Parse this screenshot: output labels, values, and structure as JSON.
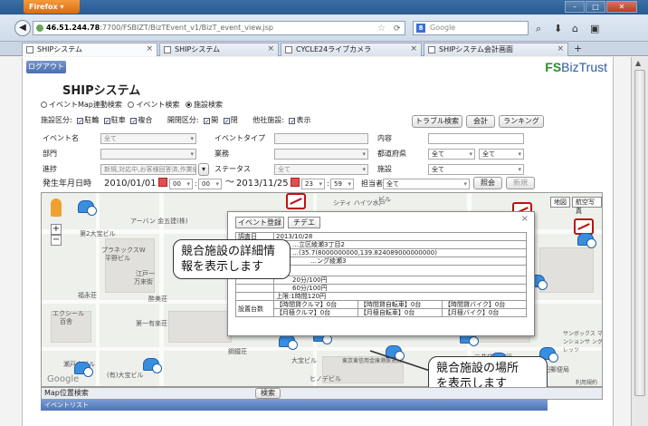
{
  "browser": {
    "firefox_label": "Firefox ▾",
    "window_controls": [
      "–",
      "□",
      "✕"
    ],
    "url_host": "46.51.244.78",
    "url_path": ":7700/FSBIZT/BizTEvent_v1/BizT_event_view.jsp",
    "search_placeholder": "Google",
    "tabs": [
      {
        "label": "SHIPシステム"
      },
      {
        "label": "SHIPシステム"
      },
      {
        "label": "CYCLE24ライブカメラ"
      },
      {
        "label": "SHIPシステム会計画面"
      }
    ],
    "new_tab": "+"
  },
  "header": {
    "logout": "ログアウト",
    "brand_fs": "FS",
    "brand_rest": "BizTrust",
    "title": "SHIPシステム"
  },
  "search_modes": [
    "イベントMap連動検索",
    "イベント検索",
    "施設検索"
  ],
  "filters": {
    "facility_type_label": "施設区分:",
    "facility_types": [
      "駐輪",
      "駐車",
      "複合"
    ],
    "open_label": "開閉区分:",
    "open_types": [
      "開",
      "閉"
    ],
    "other_label": "他社施設:",
    "other_types": [
      "表示"
    ]
  },
  "buttons": {
    "trouble": "トラブル検索",
    "accounting": "会計",
    "ranking": "ランキング",
    "view": "照会",
    "new": "新規"
  },
  "form": {
    "event_name_label": "イベント名",
    "event_name_value": "全て",
    "event_type_label": "イベントタイプ",
    "content_label": "内容",
    "dept_label": "部門",
    "business_label": "業務",
    "pref_label": "都道府県",
    "pref_value": "全て",
    "city_value": "全て",
    "progress_label": "進捗",
    "progress_value": "新規,対応中,お客様回答済,作業依頼中",
    "status_label": "ステータス",
    "status_value": "全て",
    "facility_label": "施設",
    "facility_value": "全て",
    "date_label": "発生年月日時",
    "date_from": "2010/01/01",
    "hour_from": "00",
    "min_from": "00",
    "tilde": "〜",
    "date_to": "2013/11/25",
    "hour_to": "23",
    "min_to": "59",
    "assignee_label": "担当者",
    "assignee_value": "全て"
  },
  "map": {
    "labels": {
      "l1": "アーバン 金五建(株)",
      "l2": "第2大宝ビル",
      "l3": "プラネックスW",
      "l4": "平野ビル",
      "l5": "江戸一",
      "l6": "万来街",
      "l7": "福永荘",
      "l8": "酔美荘",
      "l9": "エクシール",
      "l10": "百舎",
      "l11": "第一有楽荘",
      "l12": "瀬戸内ビル",
      "l13": "(有)大宝ビル",
      "l14": "大宝ビル",
      "l15": "東京東信用金庫港原支店",
      "l16": "ヒノデビル",
      "l17": "サンボックス マンションサ ングレッツ",
      "l18": "三井住友銀行",
      "l19": "瀬田郵便局",
      "l20": "シティ ハイツ水戸",
      "l21": "鋼鐵荘",
      "l22": "ビル",
      "l23": "Google",
      "l24": "利用規約"
    },
    "map_types": [
      "地図",
      "航空写真"
    ],
    "zoom_in": "+",
    "zoom_out": "−"
  },
  "popup": {
    "tabs": [
      "イベント登録",
      "チデエ"
    ],
    "close": "×",
    "survey_date_label": "調査日",
    "survey_date": "2013/10/28",
    "line_a": "…立区綾瀬3丁目2",
    "line_b": "…(35.7(8000000000,139.824089000000000)",
    "line_c": "…ング綾瀬3",
    "fee1": "20分/100円",
    "fee2": "60分/100円",
    "fee3": "上限:1時間120円",
    "capacity_label": "設置台数",
    "cap1": "【時間貸クルマ】0台",
    "cap2": "【時間貸自転車】0台",
    "cap3": "【時間貸バイク】0台",
    "cap4": "【月極クルマ】0台",
    "cap5": "【月極自転車】0台",
    "cap6": "【月極バイク】0台"
  },
  "callouts": {
    "detail_1": "競合施設の詳細情",
    "detail_2": "報を表示します",
    "location_1": "競合施設の場所",
    "location_2": "を表示します"
  },
  "bottom": {
    "map_search_label": "Map位置検索",
    "search_button": "検索",
    "event_list": "イベントリスト"
  },
  "colors": {
    "brand_blue": "#2c5aa0",
    "brand_green": "#2e8b2e",
    "marker_blue": "#3a8ee0"
  }
}
